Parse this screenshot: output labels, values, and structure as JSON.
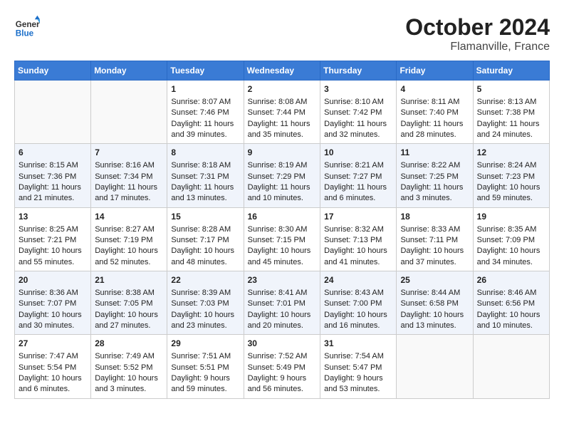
{
  "header": {
    "logo_line1": "General",
    "logo_line2": "Blue",
    "title": "October 2024",
    "subtitle": "Flamanville, France"
  },
  "days_of_week": [
    "Sunday",
    "Monday",
    "Tuesday",
    "Wednesday",
    "Thursday",
    "Friday",
    "Saturday"
  ],
  "weeks": [
    [
      {
        "day": "",
        "content": ""
      },
      {
        "day": "",
        "content": ""
      },
      {
        "day": "1",
        "content": "Sunrise: 8:07 AM\nSunset: 7:46 PM\nDaylight: 11 hours and 39 minutes."
      },
      {
        "day": "2",
        "content": "Sunrise: 8:08 AM\nSunset: 7:44 PM\nDaylight: 11 hours and 35 minutes."
      },
      {
        "day": "3",
        "content": "Sunrise: 8:10 AM\nSunset: 7:42 PM\nDaylight: 11 hours and 32 minutes."
      },
      {
        "day": "4",
        "content": "Sunrise: 8:11 AM\nSunset: 7:40 PM\nDaylight: 11 hours and 28 minutes."
      },
      {
        "day": "5",
        "content": "Sunrise: 8:13 AM\nSunset: 7:38 PM\nDaylight: 11 hours and 24 minutes."
      }
    ],
    [
      {
        "day": "6",
        "content": "Sunrise: 8:15 AM\nSunset: 7:36 PM\nDaylight: 11 hours and 21 minutes."
      },
      {
        "day": "7",
        "content": "Sunrise: 8:16 AM\nSunset: 7:34 PM\nDaylight: 11 hours and 17 minutes."
      },
      {
        "day": "8",
        "content": "Sunrise: 8:18 AM\nSunset: 7:31 PM\nDaylight: 11 hours and 13 minutes."
      },
      {
        "day": "9",
        "content": "Sunrise: 8:19 AM\nSunset: 7:29 PM\nDaylight: 11 hours and 10 minutes."
      },
      {
        "day": "10",
        "content": "Sunrise: 8:21 AM\nSunset: 7:27 PM\nDaylight: 11 hours and 6 minutes."
      },
      {
        "day": "11",
        "content": "Sunrise: 8:22 AM\nSunset: 7:25 PM\nDaylight: 11 hours and 3 minutes."
      },
      {
        "day": "12",
        "content": "Sunrise: 8:24 AM\nSunset: 7:23 PM\nDaylight: 10 hours and 59 minutes."
      }
    ],
    [
      {
        "day": "13",
        "content": "Sunrise: 8:25 AM\nSunset: 7:21 PM\nDaylight: 10 hours and 55 minutes."
      },
      {
        "day": "14",
        "content": "Sunrise: 8:27 AM\nSunset: 7:19 PM\nDaylight: 10 hours and 52 minutes."
      },
      {
        "day": "15",
        "content": "Sunrise: 8:28 AM\nSunset: 7:17 PM\nDaylight: 10 hours and 48 minutes."
      },
      {
        "day": "16",
        "content": "Sunrise: 8:30 AM\nSunset: 7:15 PM\nDaylight: 10 hours and 45 minutes."
      },
      {
        "day": "17",
        "content": "Sunrise: 8:32 AM\nSunset: 7:13 PM\nDaylight: 10 hours and 41 minutes."
      },
      {
        "day": "18",
        "content": "Sunrise: 8:33 AM\nSunset: 7:11 PM\nDaylight: 10 hours and 37 minutes."
      },
      {
        "day": "19",
        "content": "Sunrise: 8:35 AM\nSunset: 7:09 PM\nDaylight: 10 hours and 34 minutes."
      }
    ],
    [
      {
        "day": "20",
        "content": "Sunrise: 8:36 AM\nSunset: 7:07 PM\nDaylight: 10 hours and 30 minutes."
      },
      {
        "day": "21",
        "content": "Sunrise: 8:38 AM\nSunset: 7:05 PM\nDaylight: 10 hours and 27 minutes."
      },
      {
        "day": "22",
        "content": "Sunrise: 8:39 AM\nSunset: 7:03 PM\nDaylight: 10 hours and 23 minutes."
      },
      {
        "day": "23",
        "content": "Sunrise: 8:41 AM\nSunset: 7:01 PM\nDaylight: 10 hours and 20 minutes."
      },
      {
        "day": "24",
        "content": "Sunrise: 8:43 AM\nSunset: 7:00 PM\nDaylight: 10 hours and 16 minutes."
      },
      {
        "day": "25",
        "content": "Sunrise: 8:44 AM\nSunset: 6:58 PM\nDaylight: 10 hours and 13 minutes."
      },
      {
        "day": "26",
        "content": "Sunrise: 8:46 AM\nSunset: 6:56 PM\nDaylight: 10 hours and 10 minutes."
      }
    ],
    [
      {
        "day": "27",
        "content": "Sunrise: 7:47 AM\nSunset: 5:54 PM\nDaylight: 10 hours and 6 minutes."
      },
      {
        "day": "28",
        "content": "Sunrise: 7:49 AM\nSunset: 5:52 PM\nDaylight: 10 hours and 3 minutes."
      },
      {
        "day": "29",
        "content": "Sunrise: 7:51 AM\nSunset: 5:51 PM\nDaylight: 9 hours and 59 minutes."
      },
      {
        "day": "30",
        "content": "Sunrise: 7:52 AM\nSunset: 5:49 PM\nDaylight: 9 hours and 56 minutes."
      },
      {
        "day": "31",
        "content": "Sunrise: 7:54 AM\nSunset: 5:47 PM\nDaylight: 9 hours and 53 minutes."
      },
      {
        "day": "",
        "content": ""
      },
      {
        "day": "",
        "content": ""
      }
    ]
  ]
}
